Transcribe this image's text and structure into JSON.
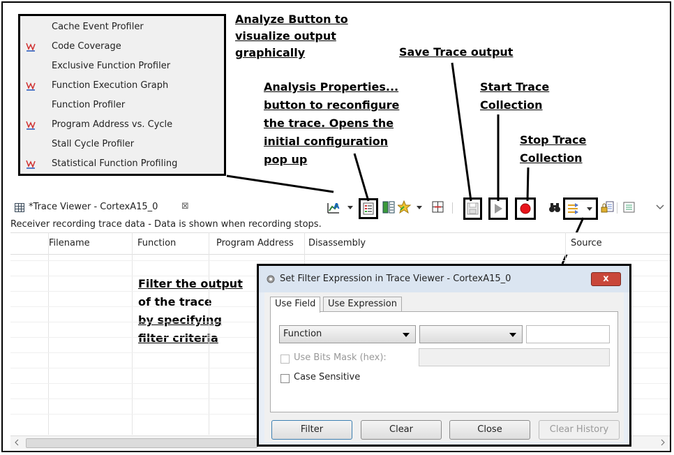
{
  "analyze_menu": {
    "items": [
      {
        "label": "Cache Event Profiler",
        "has_icon": false
      },
      {
        "label": "Code Coverage",
        "has_icon": true
      },
      {
        "label": "Exclusive Function Profiler",
        "has_icon": false
      },
      {
        "label": "Function Execution Graph",
        "has_icon": true
      },
      {
        "label": "Function Profiler",
        "has_icon": false
      },
      {
        "label": "Program Address vs. Cycle",
        "has_icon": true
      },
      {
        "label": "Stall Cycle Profiler",
        "has_icon": false
      },
      {
        "label": "Statistical Function Profiling",
        "has_icon": true
      }
    ]
  },
  "callouts": {
    "analyze": [
      "Analyze Button to",
      "visualize output",
      "graphically"
    ],
    "save": [
      "Save Trace output"
    ],
    "properties": [
      "Analysis Properties...",
      "button to reconfigure",
      "the trace. Opens the",
      "initial configuration",
      "pop up"
    ],
    "start": [
      "Start Trace",
      "Collection"
    ],
    "stop": [
      "Stop Trace",
      "Collection"
    ],
    "filter": [
      "Filter the output",
      "of the trace",
      "by specifying",
      "filter criteria"
    ]
  },
  "view": {
    "tab_label": "*Trace Viewer - CortexA15_0",
    "tab_close": "⊠",
    "status": "Receiver recording trace data - Data is shown when recording stops.",
    "columns": [
      "Filename",
      "Function",
      "Program Address",
      "Disassembly",
      "Source"
    ]
  },
  "dialog": {
    "title": "Set Filter Expression in Trace Viewer - CortexA15_0",
    "close": "x",
    "tabs": [
      "Use Field",
      "Use Expression"
    ],
    "field_select": "Function",
    "operator_select": "",
    "value_input": "",
    "use_bits_mask_label": "Use Bits Mask (hex):",
    "bits_mask_value": "",
    "case_sensitive_label": "Case Sensitive",
    "buttons": {
      "filter": "Filter",
      "clear": "Clear",
      "close": "Close",
      "clear_history": "Clear History"
    }
  },
  "colors": {
    "record": "#e8141b",
    "accent_title": "#dbe5f1",
    "close_red": "#c9473a"
  }
}
